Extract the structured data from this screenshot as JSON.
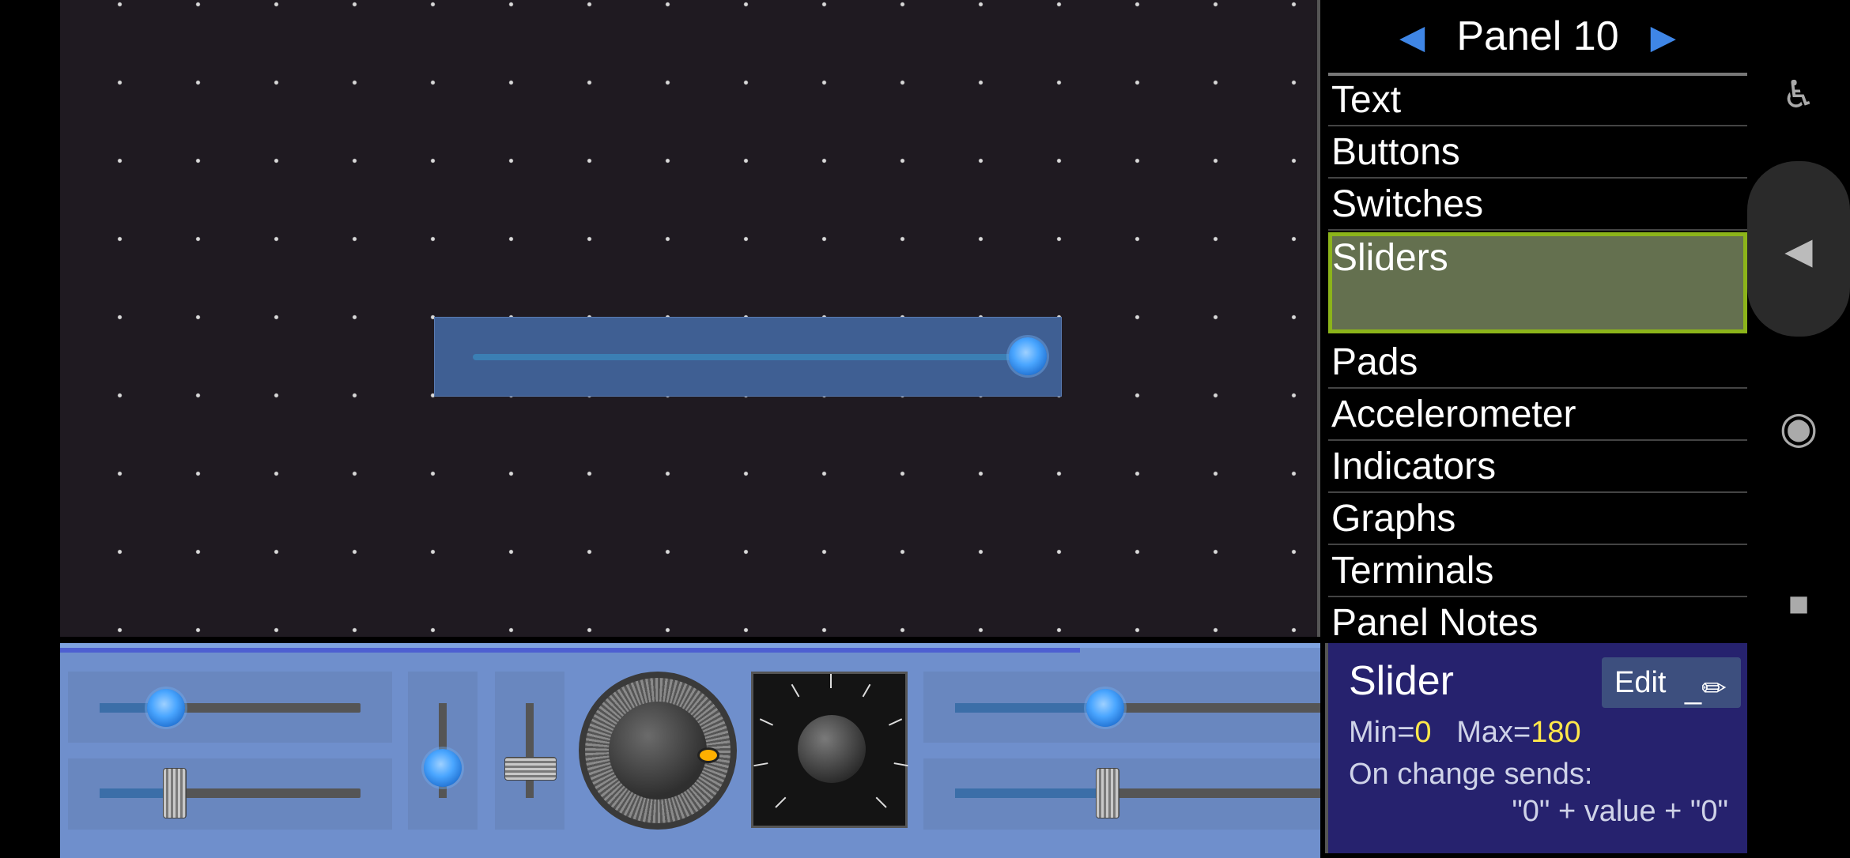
{
  "panel": {
    "title": "Panel 10",
    "prev_icon": "left-triangle-icon",
    "next_icon": "right-triangle-icon"
  },
  "categories": [
    {
      "label": "Text"
    },
    {
      "label": "Buttons"
    },
    {
      "label": "Switches"
    },
    {
      "label": "Sliders",
      "selected": true
    },
    {
      "label": "Pads"
    },
    {
      "label": "Accelerometer"
    },
    {
      "label": "Indicators"
    },
    {
      "label": "Graphs"
    },
    {
      "label": "Terminals"
    },
    {
      "label": "Panel Notes"
    }
  ],
  "canvas": {
    "placed_slider_value_fraction": 0.97
  },
  "info": {
    "title": "Slider",
    "edit_label": "Edit",
    "min_label": "Min=",
    "min_value": "0",
    "max_label": "Max=",
    "max_value": "180",
    "sends_label": "On change sends:",
    "sends_value": "\"0\" + value + \"0\""
  },
  "nav": {
    "accessibility_icon": "accessibility-icon",
    "back_icon": "back-triangle-icon",
    "home_icon": "home-circle-icon",
    "recents_icon": "recents-square-icon"
  },
  "colors": {
    "canvas_bg": "#1f1a21",
    "selection_border": "#8cb41a",
    "selection_fill": "#64704f",
    "palette_bg": "#6f8fcc",
    "info_bg": "#26226e",
    "accent_yellow": "#ffe84a",
    "knob_blue": "#4aa6ff"
  }
}
